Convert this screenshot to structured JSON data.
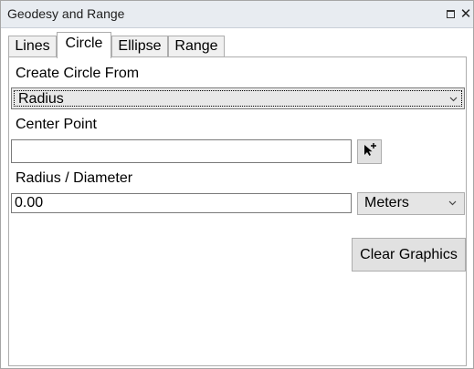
{
  "window": {
    "title": "Geodesy and Range",
    "restore_icon": "restore-icon",
    "close_icon": "close-icon",
    "close_glyph": "✕"
  },
  "tabs": [
    {
      "label": "Lines",
      "active": false
    },
    {
      "label": "Circle",
      "active": true
    },
    {
      "label": "Ellipse",
      "active": false
    },
    {
      "label": "Range",
      "active": false
    }
  ],
  "circle_panel": {
    "create_from_label": "Create Circle From",
    "create_from_value": "Radius",
    "center_point_label": "Center Point",
    "center_point_value": "",
    "map_point_tool_icon": "map-point-add-icon",
    "radius_label": "Radius / Diameter",
    "radius_value": "0.00",
    "units_value": "Meters",
    "clear_graphics_label": "Clear Graphics"
  },
  "colors": {
    "titlebar_bg": "#e8ecf1",
    "button_bg": "#e1e1e1",
    "border": "#adadad"
  }
}
